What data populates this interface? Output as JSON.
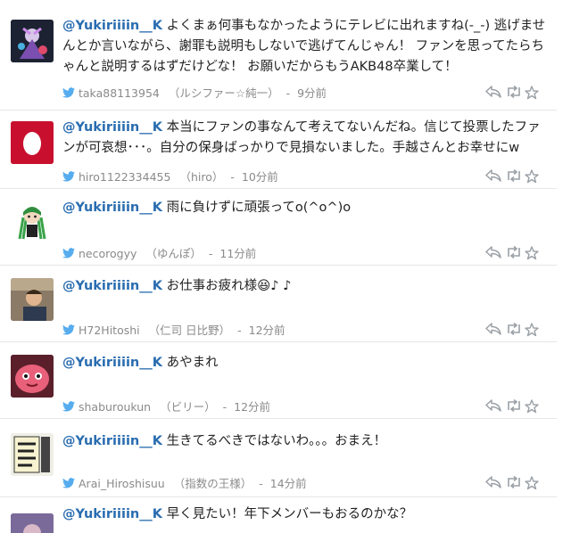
{
  "colors": {
    "mention": "#2a6db0",
    "bird": "#55acee",
    "meta": "#8a8a8a",
    "divider": "#e6e6e6"
  },
  "tweets": [
    {
      "mention": "@Yukiriiiin__K",
      "text": "よくまぁ何事もなかったようにテレビに出れますね(-_-) 逃げませんとか言いながら、謝罪も説明もしないで逃げてんじゃん！ ファンを思ってたらちゃんと説明するはずだけどな！ お願いだからもうAKB48卒業して！",
      "screen_name": "taka88113954",
      "display_name": "（ルシファー☆純一）",
      "time": "9分前",
      "avatar": "game-character"
    },
    {
      "mention": "@Yukiriiiin__K",
      "text": "本当にファンの事なんて考えてないんだね。信じて投票したファンが可哀想･･･。自分の保身ばっかりで見損ないました。手越さんとお幸せにw",
      "screen_name": "hiro1122334455",
      "display_name": "（hiro）",
      "time": "10分前",
      "avatar": "egg"
    },
    {
      "mention": "@Yukiriiiin__K",
      "text": "雨に負けずに頑張ってo(^o^)o",
      "screen_name": "necorogyy",
      "display_name": "（ゆんぽ）",
      "time": "11分前",
      "avatar": "green-hair-character"
    },
    {
      "mention": "@Yukiriiiin__K",
      "text": "お仕事お疲れ様😆♪ ♪",
      "screen_name": "H72Hitoshi",
      "display_name": "（仁司 日比野）",
      "time": "12分前",
      "avatar": "photo-person"
    },
    {
      "mention": "@Yukiriiiin__K",
      "text": "あやまれ",
      "screen_name": "shaburoukun",
      "display_name": "（ビリー）",
      "time": "12分前",
      "avatar": "pink-monster"
    },
    {
      "mention": "@Yukiriiiin__K",
      "text": "生きてるべきではないわ。。。おまえ！",
      "screen_name": "Arai_Hiroshisuu",
      "display_name": "（指数の王様）",
      "time": "14分前",
      "avatar": "book-cover"
    },
    {
      "mention": "@Yukiriiiin__K",
      "text": "早く見たい！年下メンバーもおるのかな？",
      "screen_name": "",
      "display_name": "",
      "time": "",
      "avatar": "purple-photo"
    }
  ]
}
